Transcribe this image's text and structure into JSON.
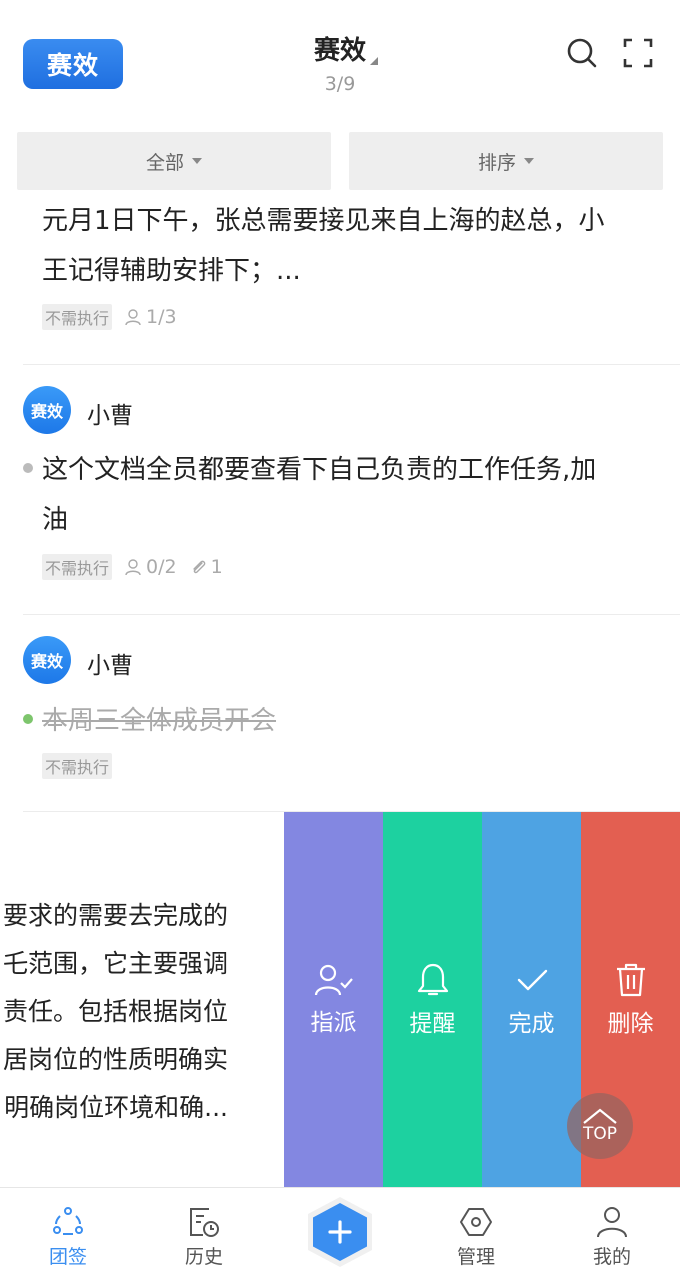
{
  "header": {
    "logo_text": "赛效",
    "title": "赛效",
    "page_count": "3/9"
  },
  "filters": {
    "all_label": "全部",
    "sort_label": "排序"
  },
  "tasks": [
    {
      "text_line1": "元月1日下午，张总需要接见来自上海的赵总，小",
      "text_line2": "王记得辅助安排下；...",
      "badge": "不需执行",
      "members": "1/3"
    },
    {
      "avatar_text": "赛效",
      "user": "小曹",
      "text_line1": "这个文档全员都要查看下自己负责的工作任务,加",
      "text_line2": "油",
      "badge": "不需执行",
      "members": "0/2",
      "attachments": "1"
    },
    {
      "avatar_text": "赛效",
      "user": "小曹",
      "text_line1": "本周三全体成员开会",
      "badge": "不需执行",
      "completed": true
    }
  ],
  "swiped_task": {
    "lines": [
      "要求的需要去完成的",
      "乇范围，它主要强调",
      "责任。包括根据岗位",
      "居岗位的性质明确实",
      "明确岗位环境和确..."
    ]
  },
  "actions": {
    "assign": "指派",
    "remind": "提醒",
    "done": "完成",
    "delete": "删除"
  },
  "top_button": "TOP",
  "bottom_nav": {
    "team": "团签",
    "history": "历史",
    "manage": "管理",
    "mine": "我的"
  },
  "colors": {
    "brand": "#3a8ef0",
    "assign": "#8387e1",
    "remind": "#1dd1a0",
    "done": "#4ea3e3",
    "delete": "#e35f51"
  }
}
